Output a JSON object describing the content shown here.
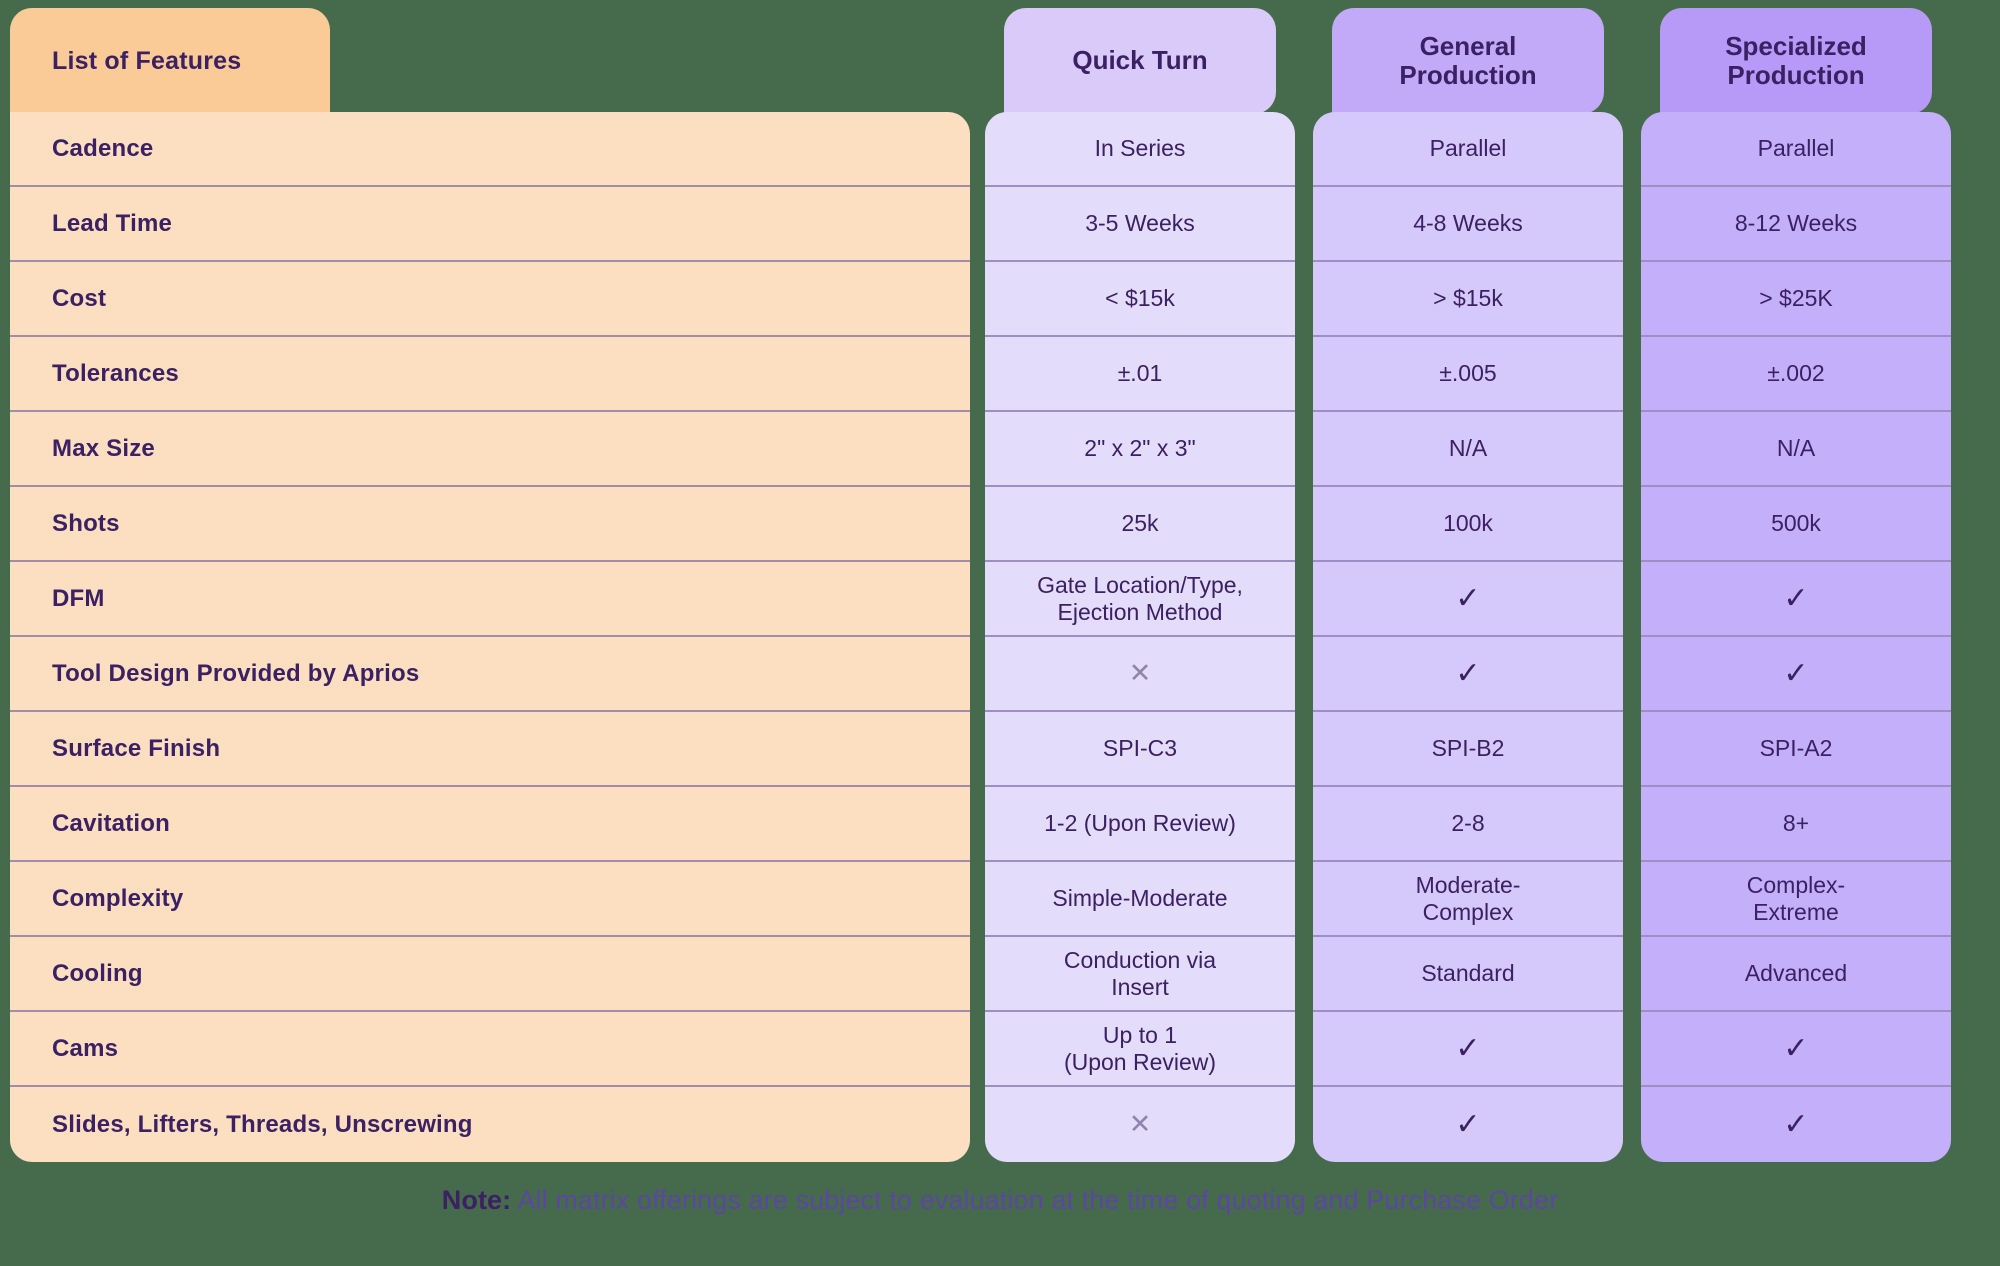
{
  "colors": {
    "page_background": "#466b4c",
    "feature_tab": "#fbcb97",
    "feature_body": "#fcdfc0",
    "feature_text": "#3b2063",
    "quick_turn_tab": "#d9caf9",
    "quick_turn_body": "#e4dcfb",
    "general_tab": "#c3aaf9",
    "general_body": "#d5c8fb",
    "specialized_tab": "#b79af8",
    "specialized_body": "#c4b0fa",
    "divider": "#a38ca8",
    "cross_mark": "#9084ad",
    "note_text": "#5b46a0"
  },
  "feature_column": {
    "header": "List of Features",
    "rows": [
      "Cadence",
      "Lead Time",
      "Cost",
      "Tolerances",
      "Max Size",
      "Shots",
      "DFM",
      "Tool Design Provided by Aprios",
      "Surface Finish",
      "Cavitation",
      "Complexity",
      "Cooling",
      "Cams",
      "Slides, Lifters, Threads, Unscrewing"
    ]
  },
  "plans": [
    {
      "name": "Quick Turn",
      "header": "Quick Turn",
      "values": [
        {
          "text": "In Series",
          "kind": "text"
        },
        {
          "text": "3-5 Weeks",
          "kind": "text"
        },
        {
          "text": "< $15k",
          "kind": "text"
        },
        {
          "text": "±.01",
          "kind": "text"
        },
        {
          "text": "2\" x 2\" x 3\"",
          "kind": "text"
        },
        {
          "text": "25k",
          "kind": "text"
        },
        {
          "text": "Gate Location/Type,\nEjection Method",
          "kind": "text"
        },
        {
          "text": "✕",
          "kind": "cross"
        },
        {
          "text": "SPI-C3",
          "kind": "text"
        },
        {
          "text": "1-2 (Upon Review)",
          "kind": "text"
        },
        {
          "text": "Simple-Moderate",
          "kind": "text"
        },
        {
          "text": "Conduction via\nInsert",
          "kind": "text"
        },
        {
          "text": "Up to 1\n(Upon Review)",
          "kind": "text"
        },
        {
          "text": "✕",
          "kind": "cross"
        }
      ]
    },
    {
      "name": "General Production",
      "header": "General\nProduction",
      "values": [
        {
          "text": "Parallel",
          "kind": "text"
        },
        {
          "text": "4-8 Weeks",
          "kind": "text"
        },
        {
          "text": "> $15k",
          "kind": "text"
        },
        {
          "text": "±.005",
          "kind": "text"
        },
        {
          "text": "N/A",
          "kind": "text"
        },
        {
          "text": "100k",
          "kind": "text"
        },
        {
          "text": "✓",
          "kind": "check"
        },
        {
          "text": "✓",
          "kind": "check"
        },
        {
          "text": "SPI-B2",
          "kind": "text"
        },
        {
          "text": "2-8",
          "kind": "text"
        },
        {
          "text": "Moderate-\nComplex",
          "kind": "text"
        },
        {
          "text": "Standard",
          "kind": "text"
        },
        {
          "text": "✓",
          "kind": "check"
        },
        {
          "text": "✓",
          "kind": "check"
        }
      ]
    },
    {
      "name": "Specialized Production",
      "header": "Specialized\nProduction",
      "values": [
        {
          "text": "Parallel",
          "kind": "text"
        },
        {
          "text": "8-12 Weeks",
          "kind": "text"
        },
        {
          "text": "> $25K",
          "kind": "text"
        },
        {
          "text": "±.002",
          "kind": "text"
        },
        {
          "text": "N/A",
          "kind": "text"
        },
        {
          "text": "500k",
          "kind": "text"
        },
        {
          "text": "✓",
          "kind": "check"
        },
        {
          "text": "✓",
          "kind": "check"
        },
        {
          "text": "SPI-A2",
          "kind": "text"
        },
        {
          "text": "8+",
          "kind": "text"
        },
        {
          "text": "Complex-\nExtreme",
          "kind": "text"
        },
        {
          "text": "Advanced",
          "kind": "text"
        },
        {
          "text": "✓",
          "kind": "check"
        },
        {
          "text": "✓",
          "kind": "check"
        }
      ]
    }
  ],
  "note": {
    "label": "Note:",
    "text": " All matrix offerings are subject to evaluation at the time of quoting and Purchase Order"
  }
}
